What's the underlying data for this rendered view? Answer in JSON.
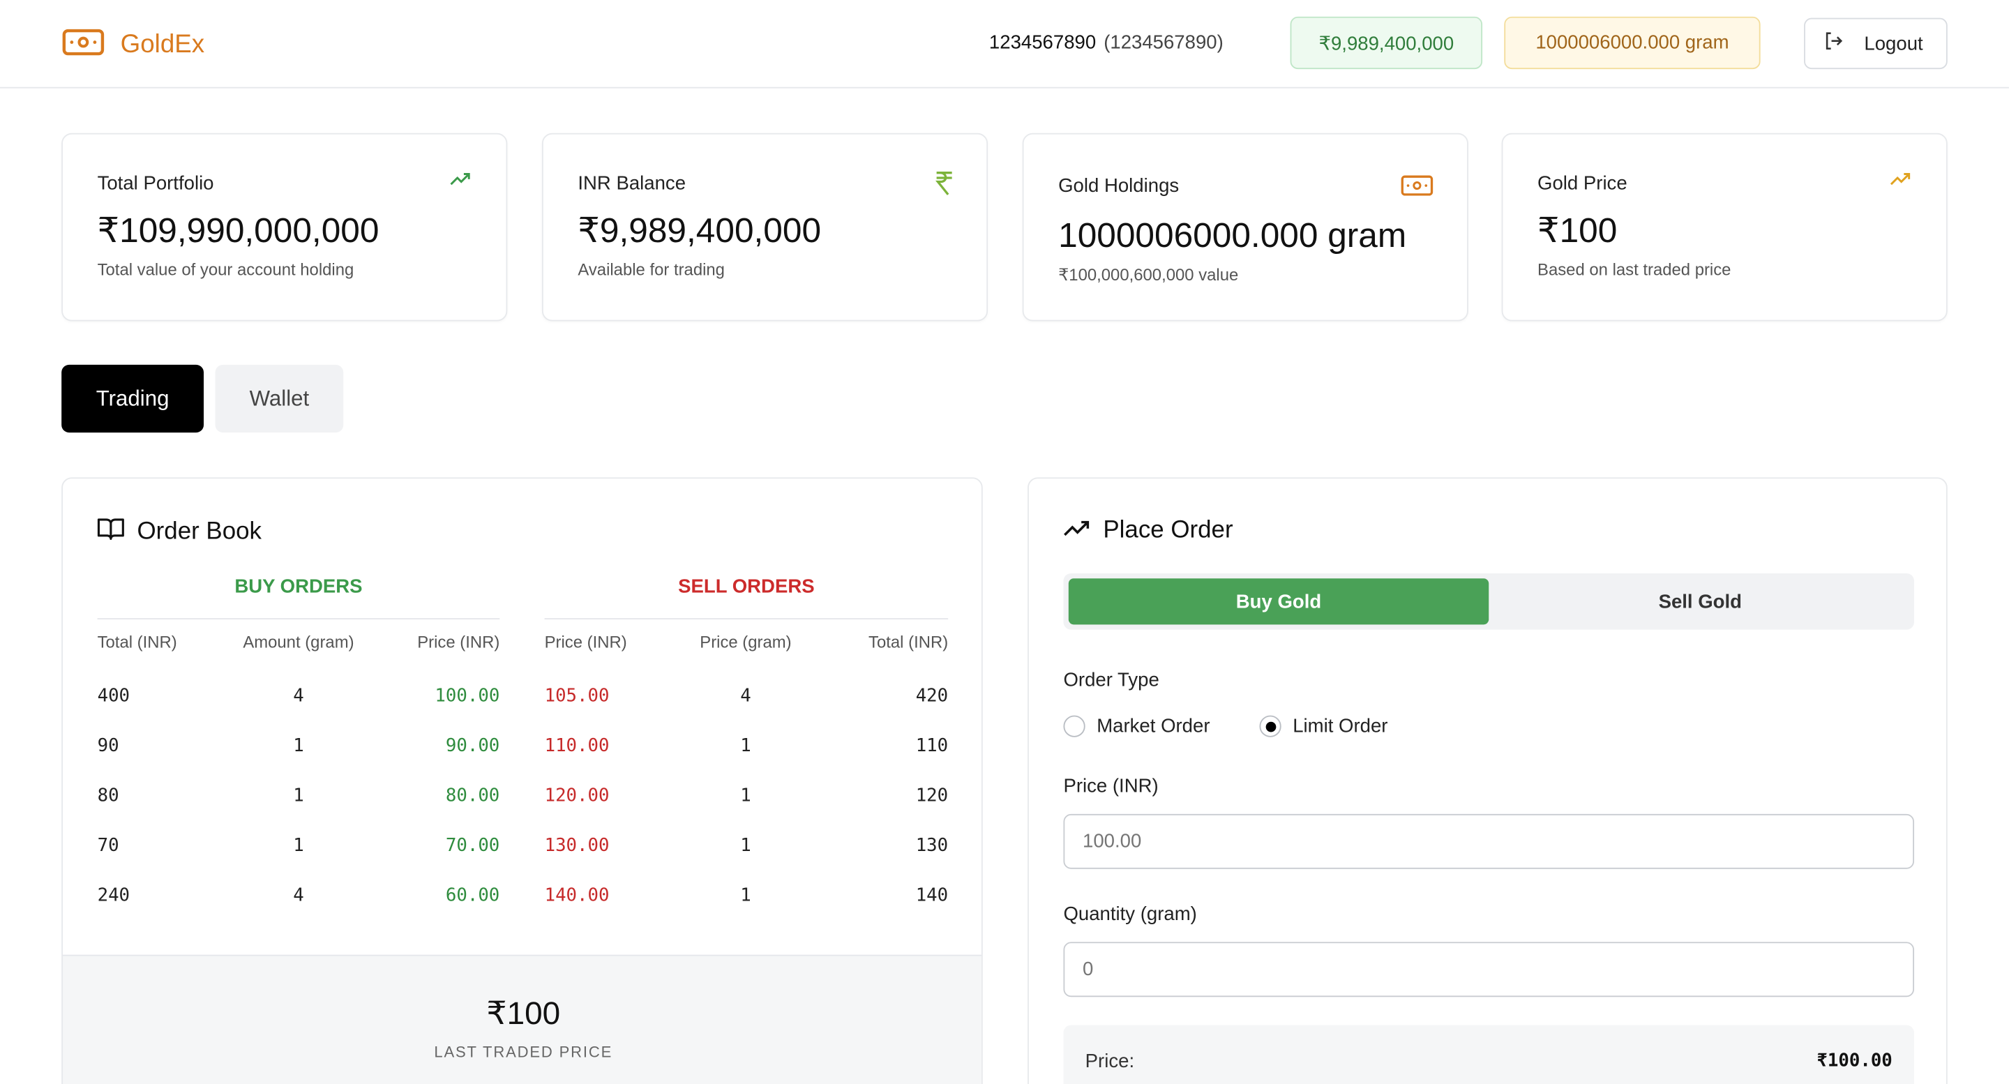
{
  "brand": {
    "name": "GoldEx",
    "accent": "#d97a1e"
  },
  "header": {
    "user_id": "1234567890",
    "user_sub": "(1234567890)",
    "inr_pill": "₹9,989,400,000",
    "gold_pill": "1000006000.000 gram",
    "logout_label": "Logout"
  },
  "cards": [
    {
      "title": "Total Portfolio",
      "icon": "trending-up-icon",
      "value": "₹109,990,000,000",
      "sub": "Total value of your account holding"
    },
    {
      "title": "INR Balance",
      "icon": "rupee-icon",
      "value": "₹9,989,400,000",
      "sub": "Available for trading"
    },
    {
      "title": "Gold Holdings",
      "icon": "banknote-icon",
      "value": "1000006000.000 gram",
      "sub": "₹100,000,600,000 value"
    },
    {
      "title": "Gold Price",
      "icon": "trending-up-icon",
      "value": "₹100",
      "sub": "Based on last traded price"
    }
  ],
  "tabs": [
    {
      "label": "Trading",
      "active": true
    },
    {
      "label": "Wallet",
      "active": false
    }
  ],
  "order_book": {
    "title": "Order Book",
    "buy_heading": "BUY ORDERS",
    "sell_heading": "SELL ORDERS",
    "buy_columns": [
      "Total (INR)",
      "Amount (gram)",
      "Price (INR)"
    ],
    "sell_columns": [
      "Price (INR)",
      "Price (gram)",
      "Total (INR)"
    ],
    "buy_rows": [
      {
        "total": "400",
        "amount": "4",
        "price": "100.00"
      },
      {
        "total": "90",
        "amount": "1",
        "price": "90.00"
      },
      {
        "total": "80",
        "amount": "1",
        "price": "80.00"
      },
      {
        "total": "70",
        "amount": "1",
        "price": "70.00"
      },
      {
        "total": "240",
        "amount": "4",
        "price": "60.00"
      }
    ],
    "sell_rows": [
      {
        "price": "105.00",
        "amount": "4",
        "total": "420"
      },
      {
        "price": "110.00",
        "amount": "1",
        "total": "110"
      },
      {
        "price": "120.00",
        "amount": "1",
        "total": "120"
      },
      {
        "price": "130.00",
        "amount": "1",
        "total": "130"
      },
      {
        "price": "140.00",
        "amount": "1",
        "total": "140"
      }
    ],
    "last_traded_value": "₹100",
    "last_traded_label": "LAST TRADED PRICE"
  },
  "place_order": {
    "title": "Place Order",
    "buy_label": "Buy Gold",
    "sell_label": "Sell Gold",
    "order_type_label": "Order Type",
    "market_label": "Market Order",
    "limit_label": "Limit Order",
    "selected_type": "limit",
    "price_label": "Price (INR)",
    "price_placeholder": "100.00",
    "qty_label": "Quantity (gram)",
    "qty_placeholder": "0",
    "summary_price_label": "Price:",
    "summary_price_value": "₹100.00"
  },
  "colors": {
    "buy": "#2f8c3e",
    "sell": "#c62a2a",
    "buy_button": "#4aa157"
  }
}
